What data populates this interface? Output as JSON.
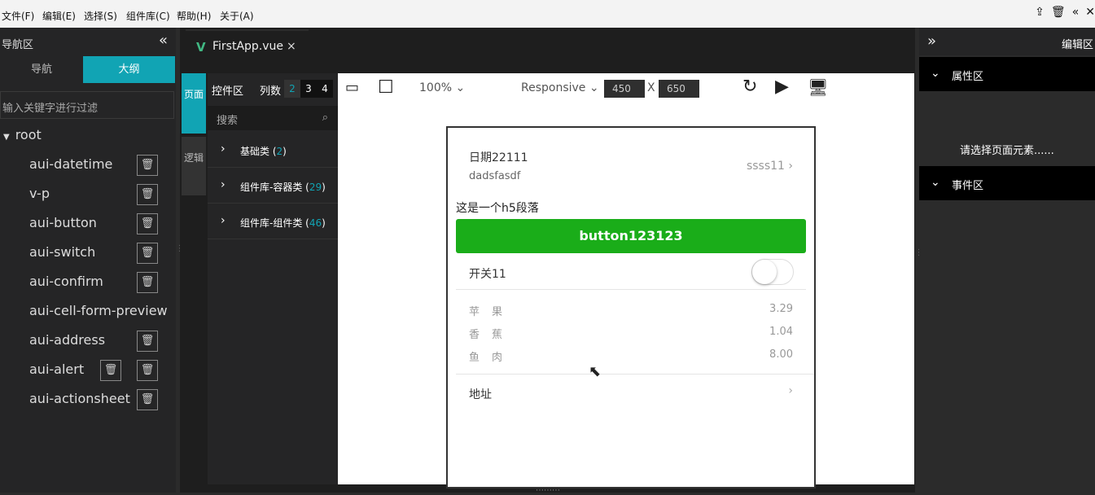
{
  "menu": {
    "file": "文件(F)",
    "edit": "编辑(E)",
    "select": "选择(S)",
    "components": "组件库(C)",
    "help": "帮助(H)",
    "about": "关于(A)"
  },
  "nav": {
    "title": "导航区",
    "tabs": {
      "nav": "导航",
      "outline": "大纲"
    },
    "filter_placeholder": "输入关键字进行过滤",
    "root": "root",
    "items": [
      "aui-datetime",
      "v-p",
      "aui-button",
      "aui-switch",
      "aui-confirm",
      "aui-cell-form-preview",
      "aui-address",
      "aui-alert",
      "aui-actionsheet"
    ]
  },
  "editor": {
    "file_tab": "FirstApp.vue"
  },
  "side_tabs": {
    "page": "页面",
    "logic": "逻辑"
  },
  "controls": {
    "title": "控件区",
    "columns_label": "列数",
    "columns": [
      "2",
      "3",
      "4"
    ],
    "selected_column": "2",
    "search_placeholder": "搜索",
    "categories": [
      {
        "label": "基础类",
        "count": "2"
      },
      {
        "label": "组件库-容器类",
        "count": "29"
      },
      {
        "label": "组件库-组件类",
        "count": "46"
      }
    ]
  },
  "toolbar": {
    "zoom": "100%",
    "responsive": "Responsive",
    "width": "450",
    "height": "650",
    "sep": "X"
  },
  "preview": {
    "date_title": "日期22111",
    "date_sub": "dadsfasdf",
    "date_value": "ssss11",
    "paragraph": "这是一个h5段落",
    "button": "button123123",
    "switch_label": "开关11",
    "switch_on": false,
    "fruits": [
      {
        "name": "苹果",
        "price": "3.29"
      },
      {
        "name": "香蕉",
        "price": "1.04"
      },
      {
        "name": "鱼肉",
        "price": "8.00"
      }
    ],
    "address": "地址"
  },
  "right": {
    "title": "编辑区",
    "props": "属性区",
    "empty": "请选择页面元素......",
    "events": "事件区"
  },
  "colors": {
    "accent": "#11a4b4",
    "button_green": "#1aad19"
  }
}
